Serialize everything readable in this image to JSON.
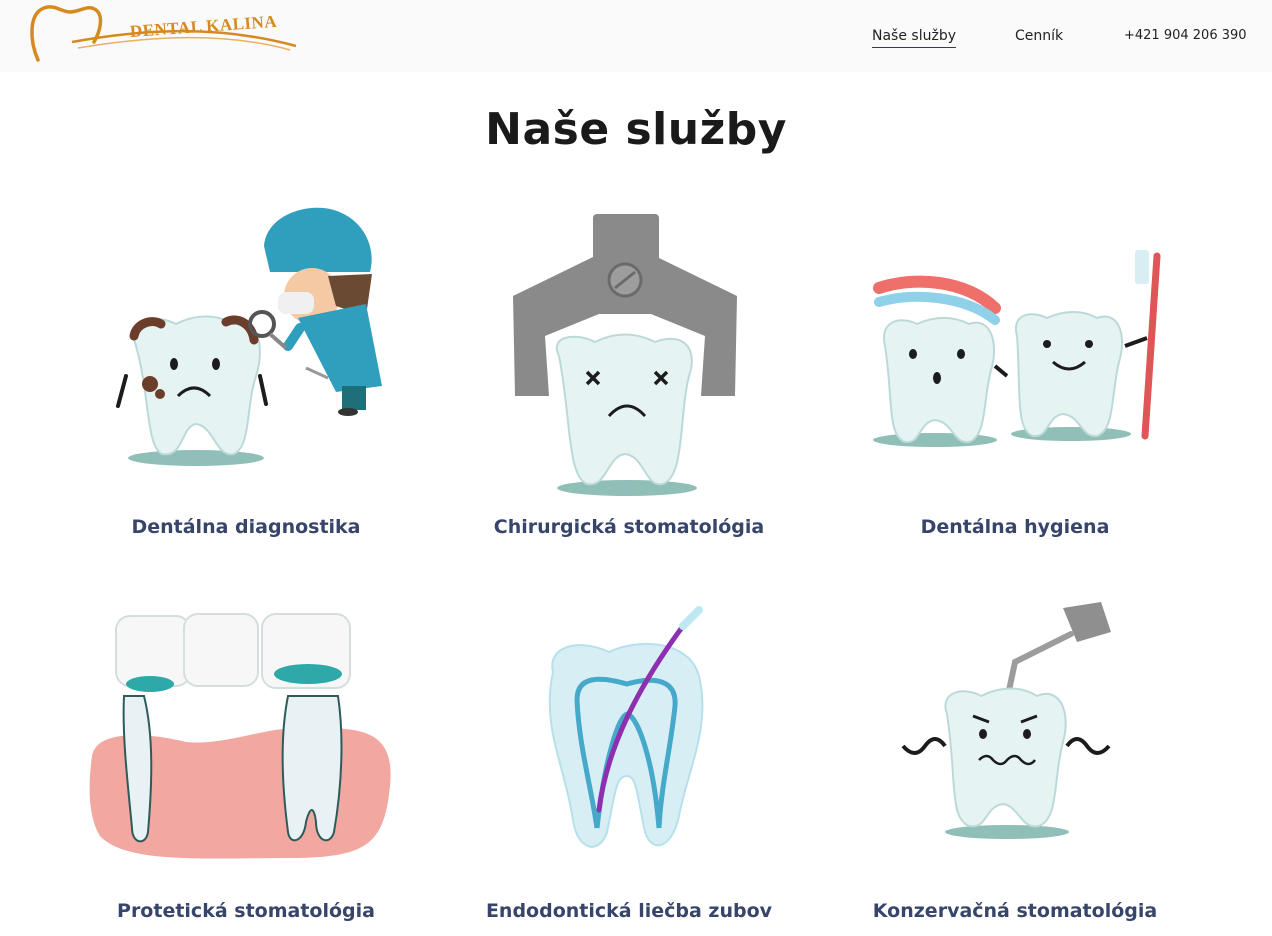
{
  "header": {
    "logo_text": "DENTAL KALINA",
    "nav": [
      {
        "label": "Naše služby",
        "active": true
      },
      {
        "label": "Cenník",
        "active": false
      },
      {
        "label": "+421 904 206 390",
        "active": false
      }
    ]
  },
  "main": {
    "title": "Naše služby",
    "services": [
      {
        "label": "Dentálna diagnostika",
        "icon": "dentist-examining-tooth-icon"
      },
      {
        "label": "Chirurgická stomatológia",
        "icon": "extraction-forceps-tooth-icon"
      },
      {
        "label": "Dentálna hygiena",
        "icon": "teeth-with-toothbrush-icon"
      },
      {
        "label": "Protetická stomatológia",
        "icon": "dental-bridge-icon"
      },
      {
        "label": "Endodontická liečba zubov",
        "icon": "root-canal-tooth-icon"
      },
      {
        "label": "Konzervačná stomatológia",
        "icon": "tooth-with-drill-icon"
      }
    ]
  },
  "colors": {
    "accent_gold": "#d6891e",
    "label_navy": "#37456a",
    "tooth_fill": "#e6f3f3",
    "shadow_teal": "#8fbfb6"
  }
}
